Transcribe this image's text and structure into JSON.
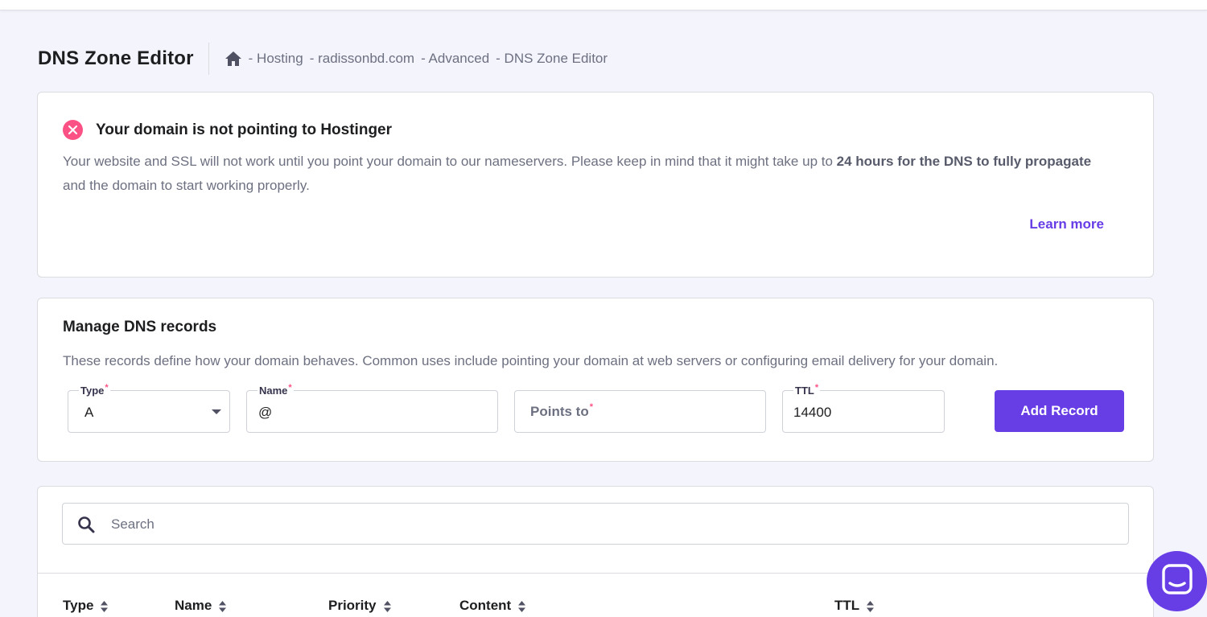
{
  "header": {
    "title": "DNS Zone Editor",
    "breadcrumb": [
      "- Hosting",
      "- radissonbd.com",
      "- Advanced",
      "- DNS Zone Editor"
    ]
  },
  "alert": {
    "title": "Your domain is not pointing to Hostinger",
    "body_pre": "Your website and SSL will not work until you point your domain to our nameservers. Please keep in mind that it might take up to ",
    "body_bold": "24 hours for the DNS to fully propagate",
    "body_post": " and the domain to start working properly.",
    "learn_more": "Learn more"
  },
  "manage": {
    "title": "Manage DNS records",
    "description": "These records define how your domain behaves. Common uses include pointing your domain at web servers or configuring email delivery for your domain.",
    "fields": {
      "type": {
        "label": "Type",
        "value": "A"
      },
      "name": {
        "label": "Name",
        "value": "@"
      },
      "points_to": {
        "placeholder": "Points to"
      },
      "ttl": {
        "label": "TTL",
        "value": "14400"
      }
    },
    "required_mark": "*",
    "add_button": "Add Record"
  },
  "records": {
    "search_placeholder": "Search",
    "columns": [
      "Type",
      "Name",
      "Priority",
      "Content",
      "TTL"
    ]
  },
  "colors": {
    "accent": "#673de6",
    "error": "#fc5185",
    "background": "#f4f4fd"
  }
}
